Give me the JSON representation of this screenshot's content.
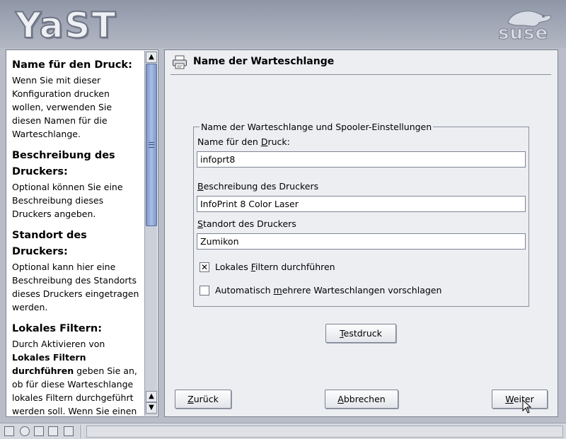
{
  "app": {
    "logo_text": "YaST",
    "vendor_logo_text": "suse"
  },
  "help": {
    "sections": [
      {
        "heading": "Name für den Druck:",
        "text": "Wenn Sie mit dieser Konfiguration drucken wollen, verwenden Sie diesen Namen für die Warteschlange."
      },
      {
        "heading": "Beschreibung des Druckers:",
        "text": "Optional können Sie eine Beschreibung dieses Druckers angeben."
      },
      {
        "heading": "Standort des Druckers:",
        "text": "Optional kann hier eine Beschreibung des Standorts dieses Druckers eingetragen werden."
      },
      {
        "heading": "Lokales Filtern:",
        "text_before": "Durch Aktivieren von ",
        "bold": "Lokales Filtern durchführen",
        "text_after": " geben Sie an, ob für diese Warteschlange lokales Filtern durchgeführt werden soll. Wenn Sie einen"
      }
    ]
  },
  "main": {
    "title": "Name der Warteschlange",
    "group_title": "Name der Warteschlange und Spooler-Einstellungen",
    "fields": {
      "name": {
        "label_pre": "Name für den ",
        "label_key": "D",
        "label_post": "ruck:",
        "value": "infoprt8"
      },
      "description": {
        "label_pre": "",
        "label_key": "B",
        "label_post": "eschreibung des Druckers",
        "value": "InfoPrint 8 Color Laser"
      },
      "location": {
        "label_pre": "",
        "label_key": "S",
        "label_post": "tandort des Druckers",
        "value": "Zumikon"
      }
    },
    "checkboxes": {
      "local_filter": {
        "label_pre": "Lokales ",
        "label_key": "F",
        "label_post": "iltern durchführen",
        "checked": true,
        "mark": "✕"
      },
      "auto_queues": {
        "label_pre": "Automatisch ",
        "label_key": "m",
        "label_post": "ehrere Warteschlangen vorschlagen",
        "checked": false,
        "mark": ""
      }
    },
    "buttons": {
      "test": {
        "pre": "",
        "key": "T",
        "post": "estdruck"
      },
      "back": {
        "pre": "",
        "key": "Z",
        "post": "urück"
      },
      "cancel": {
        "pre": "",
        "key": "A",
        "post": "bbrechen"
      },
      "next": {
        "pre": "",
        "key": "W",
        "post": "eiter"
      }
    }
  },
  "scrollbar": {
    "up_arrow": "▲",
    "down_arrow": "▼"
  }
}
